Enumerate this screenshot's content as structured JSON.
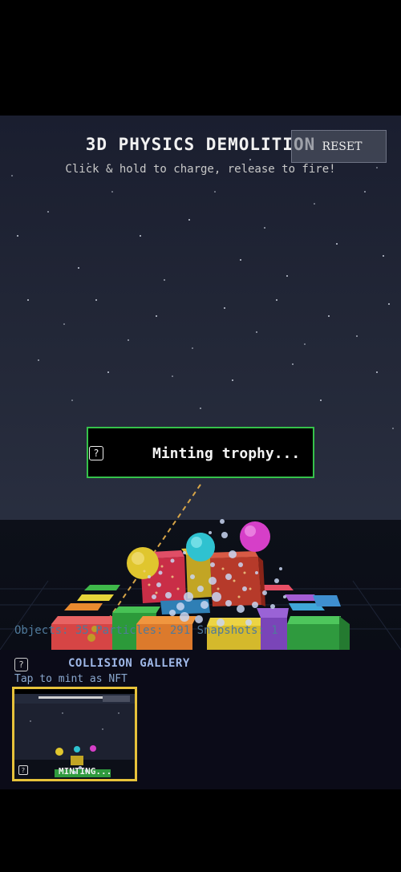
{
  "header": {
    "title": "3D PHYSICS DEMOLITION",
    "subtitle": "Click & hold to charge, release to fire!",
    "reset_label": "RESET"
  },
  "toast": {
    "icon": "question-icon",
    "message": "Minting trophy..."
  },
  "stats": {
    "text": "Objects: 35  Particles: 291  Snapshots: 1"
  },
  "gallery": {
    "title": "COLLISION GALLERY",
    "hint": "Tap to mint as NFT",
    "thumbnail": {
      "label": "MINTING..."
    }
  },
  "colors": {
    "toast_border": "#35c24a",
    "thumb_border": "#e7c23a",
    "gallery_title": "#9fb8e8",
    "stats_text": "#4f7a9b"
  }
}
